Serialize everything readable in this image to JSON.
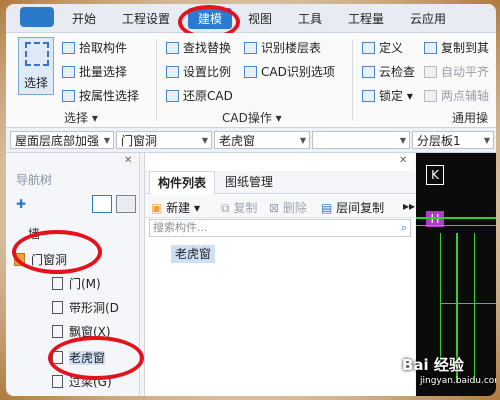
{
  "menubar": {
    "items": [
      "开始",
      "工程设置",
      "建模",
      "视图",
      "工具",
      "工程量",
      "云应用"
    ],
    "active": "建模"
  },
  "ribbon": {
    "select_big": "选择",
    "select_group": {
      "items": [
        "拾取构件",
        "批量选择",
        "按属性选择"
      ],
      "label": "选择"
    },
    "cad_group": {
      "items": [
        "查找替换",
        "识别楼层表",
        "设置比例",
        "CAD识别选项",
        "还原CAD"
      ],
      "label": "CAD操作"
    },
    "general_group": {
      "items": [
        "定义",
        "复制到其",
        "云检查",
        "自动平齐",
        "锁定",
        "两点辅轴"
      ],
      "label": "通用操"
    }
  },
  "selectors": {
    "floor": "屋面层底部加强",
    "category": "门窗洞",
    "component": "老虎窗",
    "extra": "",
    "layer": "分层板1"
  },
  "nav": {
    "title": "导航树",
    "items": [
      "墙",
      "门窗洞",
      "门(M)",
      "带形洞(D",
      "飘窗(X)",
      "老虎窗",
      "过梁(G)"
    ],
    "selected": "老虎窗"
  },
  "panel": {
    "tabs": [
      "构件列表",
      "图纸管理"
    ],
    "toolbar": {
      "new": "新建",
      "copy": "复制",
      "delete": "删除",
      "floor_copy": "层间复制"
    },
    "search_placeholder": "搜索构件...",
    "list": [
      "老虎窗"
    ]
  },
  "drawing": {
    "label_k": "K",
    "label_h": "H"
  },
  "watermark": {
    "brand": "Bai 经验",
    "url": "jingyan.baidu.com"
  },
  "colors": {
    "accent": "#2b7ad3",
    "annotation": "#e3121b",
    "selection": "#cfe0f5",
    "cad_line": "#2fd12f"
  }
}
